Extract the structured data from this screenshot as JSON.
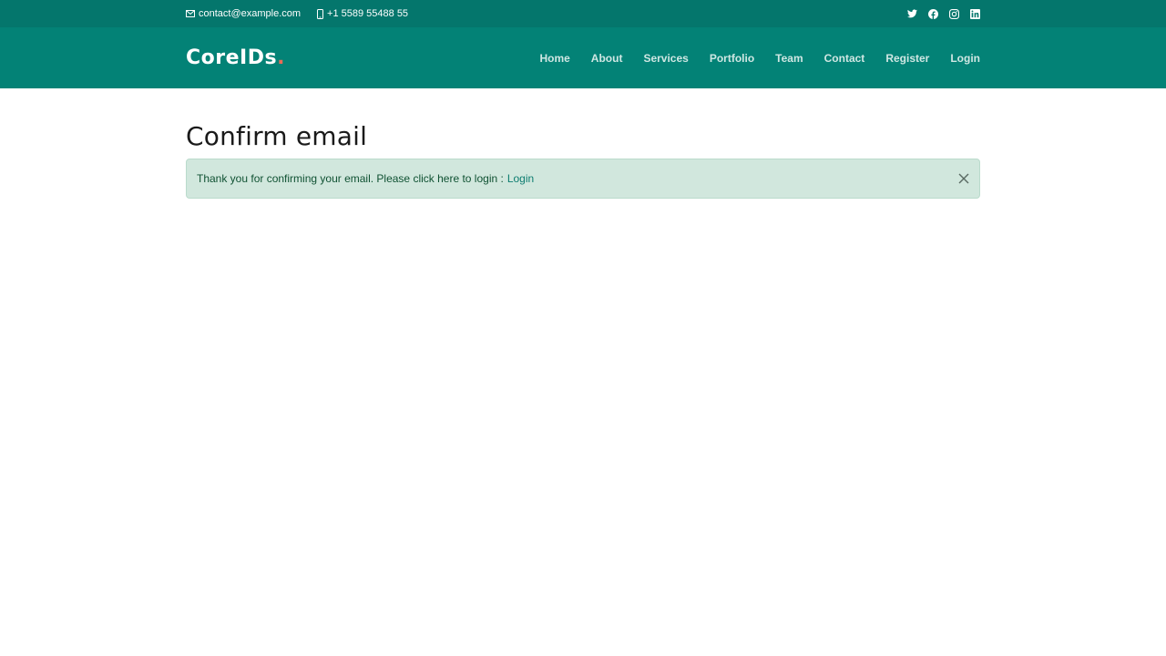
{
  "topbar": {
    "email": "contact@example.com",
    "phone": "+1 5589 55488 55",
    "email_icon": "envelope-icon",
    "phone_icon": "phone-icon",
    "social": [
      "twitter-icon",
      "facebook-icon",
      "instagram-icon",
      "linkedin-icon"
    ]
  },
  "header": {
    "logo_text": "CoreIDs",
    "logo_dot": ".",
    "nav": [
      "Home",
      "About",
      "Services",
      "Portfolio",
      "Team",
      "Contact",
      "Register",
      "Login"
    ]
  },
  "main": {
    "title": "Confirm email",
    "alert": {
      "message": "Thank you for confirming your email. Please click here to login :",
      "link_text": "Login"
    }
  },
  "colors": {
    "topbar_bg": "#04766c",
    "header_bg": "#038276",
    "accent": "#e96b56",
    "alert_bg": "#d1e7dd"
  }
}
